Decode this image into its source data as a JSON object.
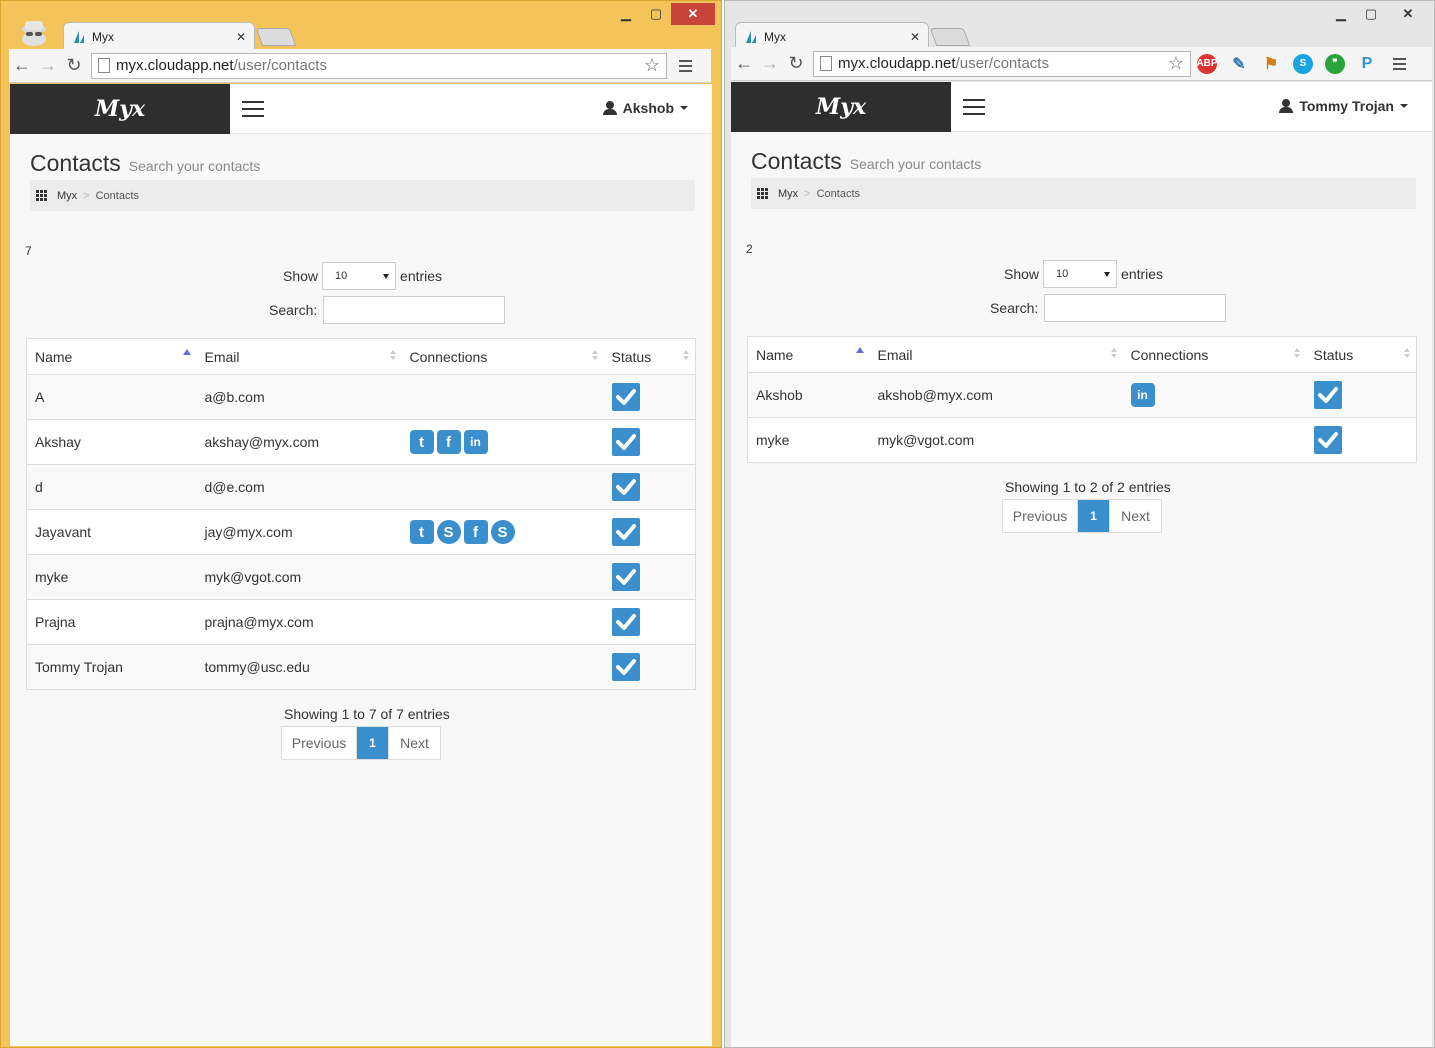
{
  "windows": [
    {
      "tab_title": "Myx",
      "url_host": "myx.cloudapp.net",
      "url_path": "/user/contacts",
      "brand": "Myx",
      "user_name": "Akshob",
      "page_title": "Contacts",
      "page_subtitle": "Search your contacts",
      "breadcrumb": [
        "Myx",
        "Contacts"
      ],
      "count": "7",
      "length_label_before": "Show",
      "length_value": "10",
      "length_label_after": "entries",
      "search_label": "Search:",
      "columns": [
        "Name",
        "Email",
        "Connections",
        "Status"
      ],
      "rows": [
        {
          "name": "A",
          "email": "a@b.com",
          "connections": [],
          "status": true
        },
        {
          "name": "Akshay",
          "email": "akshay@myx.com",
          "connections": [
            "twitter",
            "facebook",
            "linkedin"
          ],
          "status": true
        },
        {
          "name": "d",
          "email": "d@e.com",
          "connections": [],
          "status": true
        },
        {
          "name": "Jayavant",
          "email": "jay@myx.com",
          "connections": [
            "twitter",
            "skype",
            "facebook",
            "skype"
          ],
          "status": true
        },
        {
          "name": "myke",
          "email": "myk@vgot.com",
          "connections": [],
          "status": true
        },
        {
          "name": "Prajna",
          "email": "prajna@myx.com",
          "connections": [],
          "status": true
        },
        {
          "name": "Tommy Trojan",
          "email": "tommy@usc.edu",
          "connections": [],
          "status": true
        }
      ],
      "info": "Showing 1 to 7 of 7 entries",
      "pager": {
        "previous": "Previous",
        "current": "1",
        "next": "Next"
      }
    },
    {
      "tab_title": "Myx",
      "url_host": "myx.cloudapp.net",
      "url_path": "/user/contacts",
      "brand": "Myx",
      "user_name": "Tommy Trojan",
      "page_title": "Contacts",
      "page_subtitle": "Search your contacts",
      "breadcrumb": [
        "Myx",
        "Contacts"
      ],
      "count": "2",
      "length_label_before": "Show",
      "length_value": "10",
      "length_label_after": "entries",
      "search_label": "Search:",
      "columns": [
        "Name",
        "Email",
        "Connections",
        "Status"
      ],
      "rows": [
        {
          "name": "Akshob",
          "email": "akshob@myx.com",
          "connections": [
            "linkedin"
          ],
          "status": true
        },
        {
          "name": "myke",
          "email": "myk@vgot.com",
          "connections": [],
          "status": true
        }
      ],
      "info": "Showing 1 to 2 of 2 entries",
      "pager": {
        "previous": "Previous",
        "current": "1",
        "next": "Next"
      },
      "extensions": [
        "adblock-plus-icon",
        "eyedropper-icon",
        "bookmark-icon",
        "skype-icon",
        "hangouts-icon",
        "pushbullet-icon"
      ]
    }
  ],
  "colors": {
    "accent": "#3a8fcc",
    "brand_bg": "#2e2e2e",
    "active_frame": "#f2c45a"
  }
}
